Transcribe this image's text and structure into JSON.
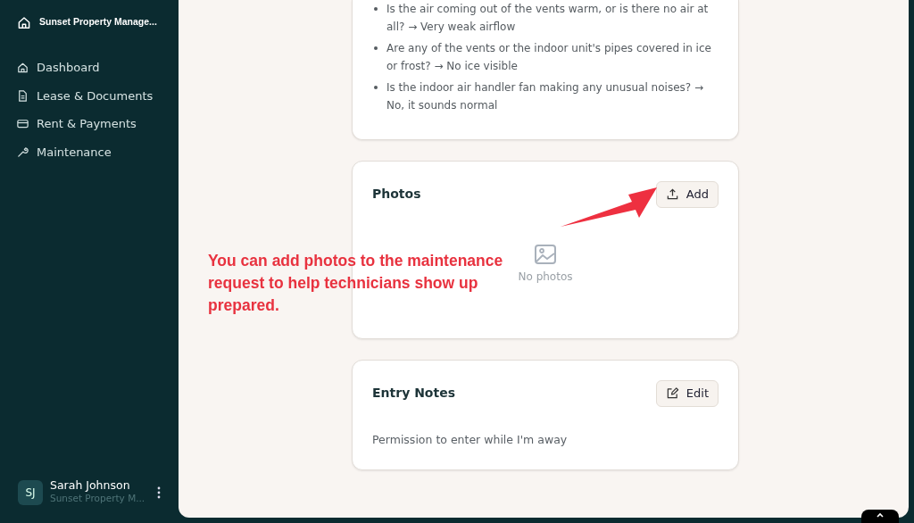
{
  "sidebar": {
    "brand": "Sunset Property Manage...",
    "items": [
      {
        "label": "Dashboard",
        "selected": false
      },
      {
        "label": "Lease & Documents",
        "selected": false
      },
      {
        "label": "Rent & Payments",
        "selected": false
      },
      {
        "label": "Maintenance",
        "selected": false
      }
    ],
    "user": {
      "initials": "SJ",
      "name": "Sarah Johnson",
      "subtitle": "Sunset Property M..."
    }
  },
  "details_card": {
    "bullets": [
      "Is the air coming out of the vents warm, or is there no air at all? → Very weak airflow",
      "Are any of the vents or the indoor unit's pipes covered in ice or frost? → No ice visible",
      "Is the indoor air handler fan making any unusual noises? → No, it sounds normal"
    ]
  },
  "photos_card": {
    "title": "Photos",
    "button": "Add",
    "empty_text": "No photos"
  },
  "entry_notes_card": {
    "title": "Entry Notes",
    "button": "Edit",
    "text": "Permission to enter while I'm away"
  },
  "annotation": {
    "text": "You can add photos to the maintenance request to help technicians show up prepared."
  }
}
